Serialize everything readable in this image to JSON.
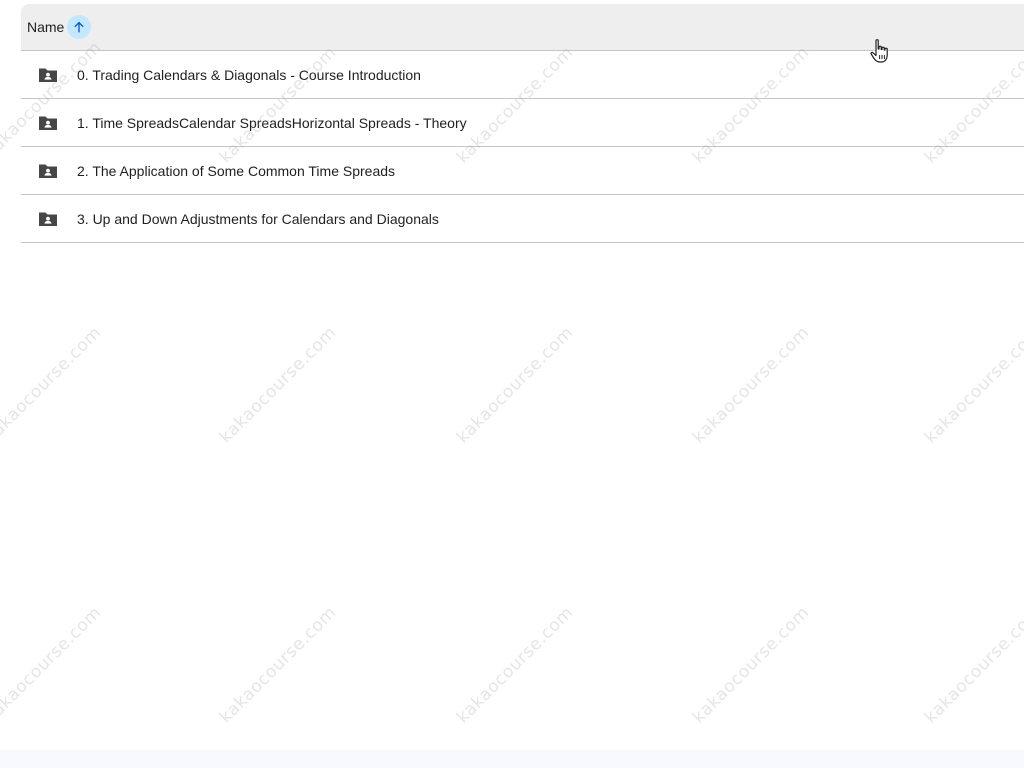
{
  "header": {
    "name_label": "Name",
    "sort_icon": "arrow-upward-icon"
  },
  "rows": [
    {
      "label": "0. Trading Calendars & Diagonals - Course Introduction",
      "icon": "shared-folder-icon"
    },
    {
      "label": "1. Time SpreadsCalendar SpreadsHorizontal Spreads - Theory",
      "icon": "shared-folder-icon"
    },
    {
      "label": "2. The Application of Some Common Time Spreads",
      "icon": "shared-folder-icon"
    },
    {
      "label": "3. Up and Down Adjustments for Calendars and Diagonals",
      "icon": "shared-folder-icon"
    }
  ],
  "watermark": "kakaocourse.com",
  "colors": {
    "header_bg": "#eeeeee",
    "sort_bg": "#c2e7ff",
    "sort_arrow": "#0b57d0",
    "folder_icon": "#444746",
    "divider": "#c4c7c5"
  }
}
